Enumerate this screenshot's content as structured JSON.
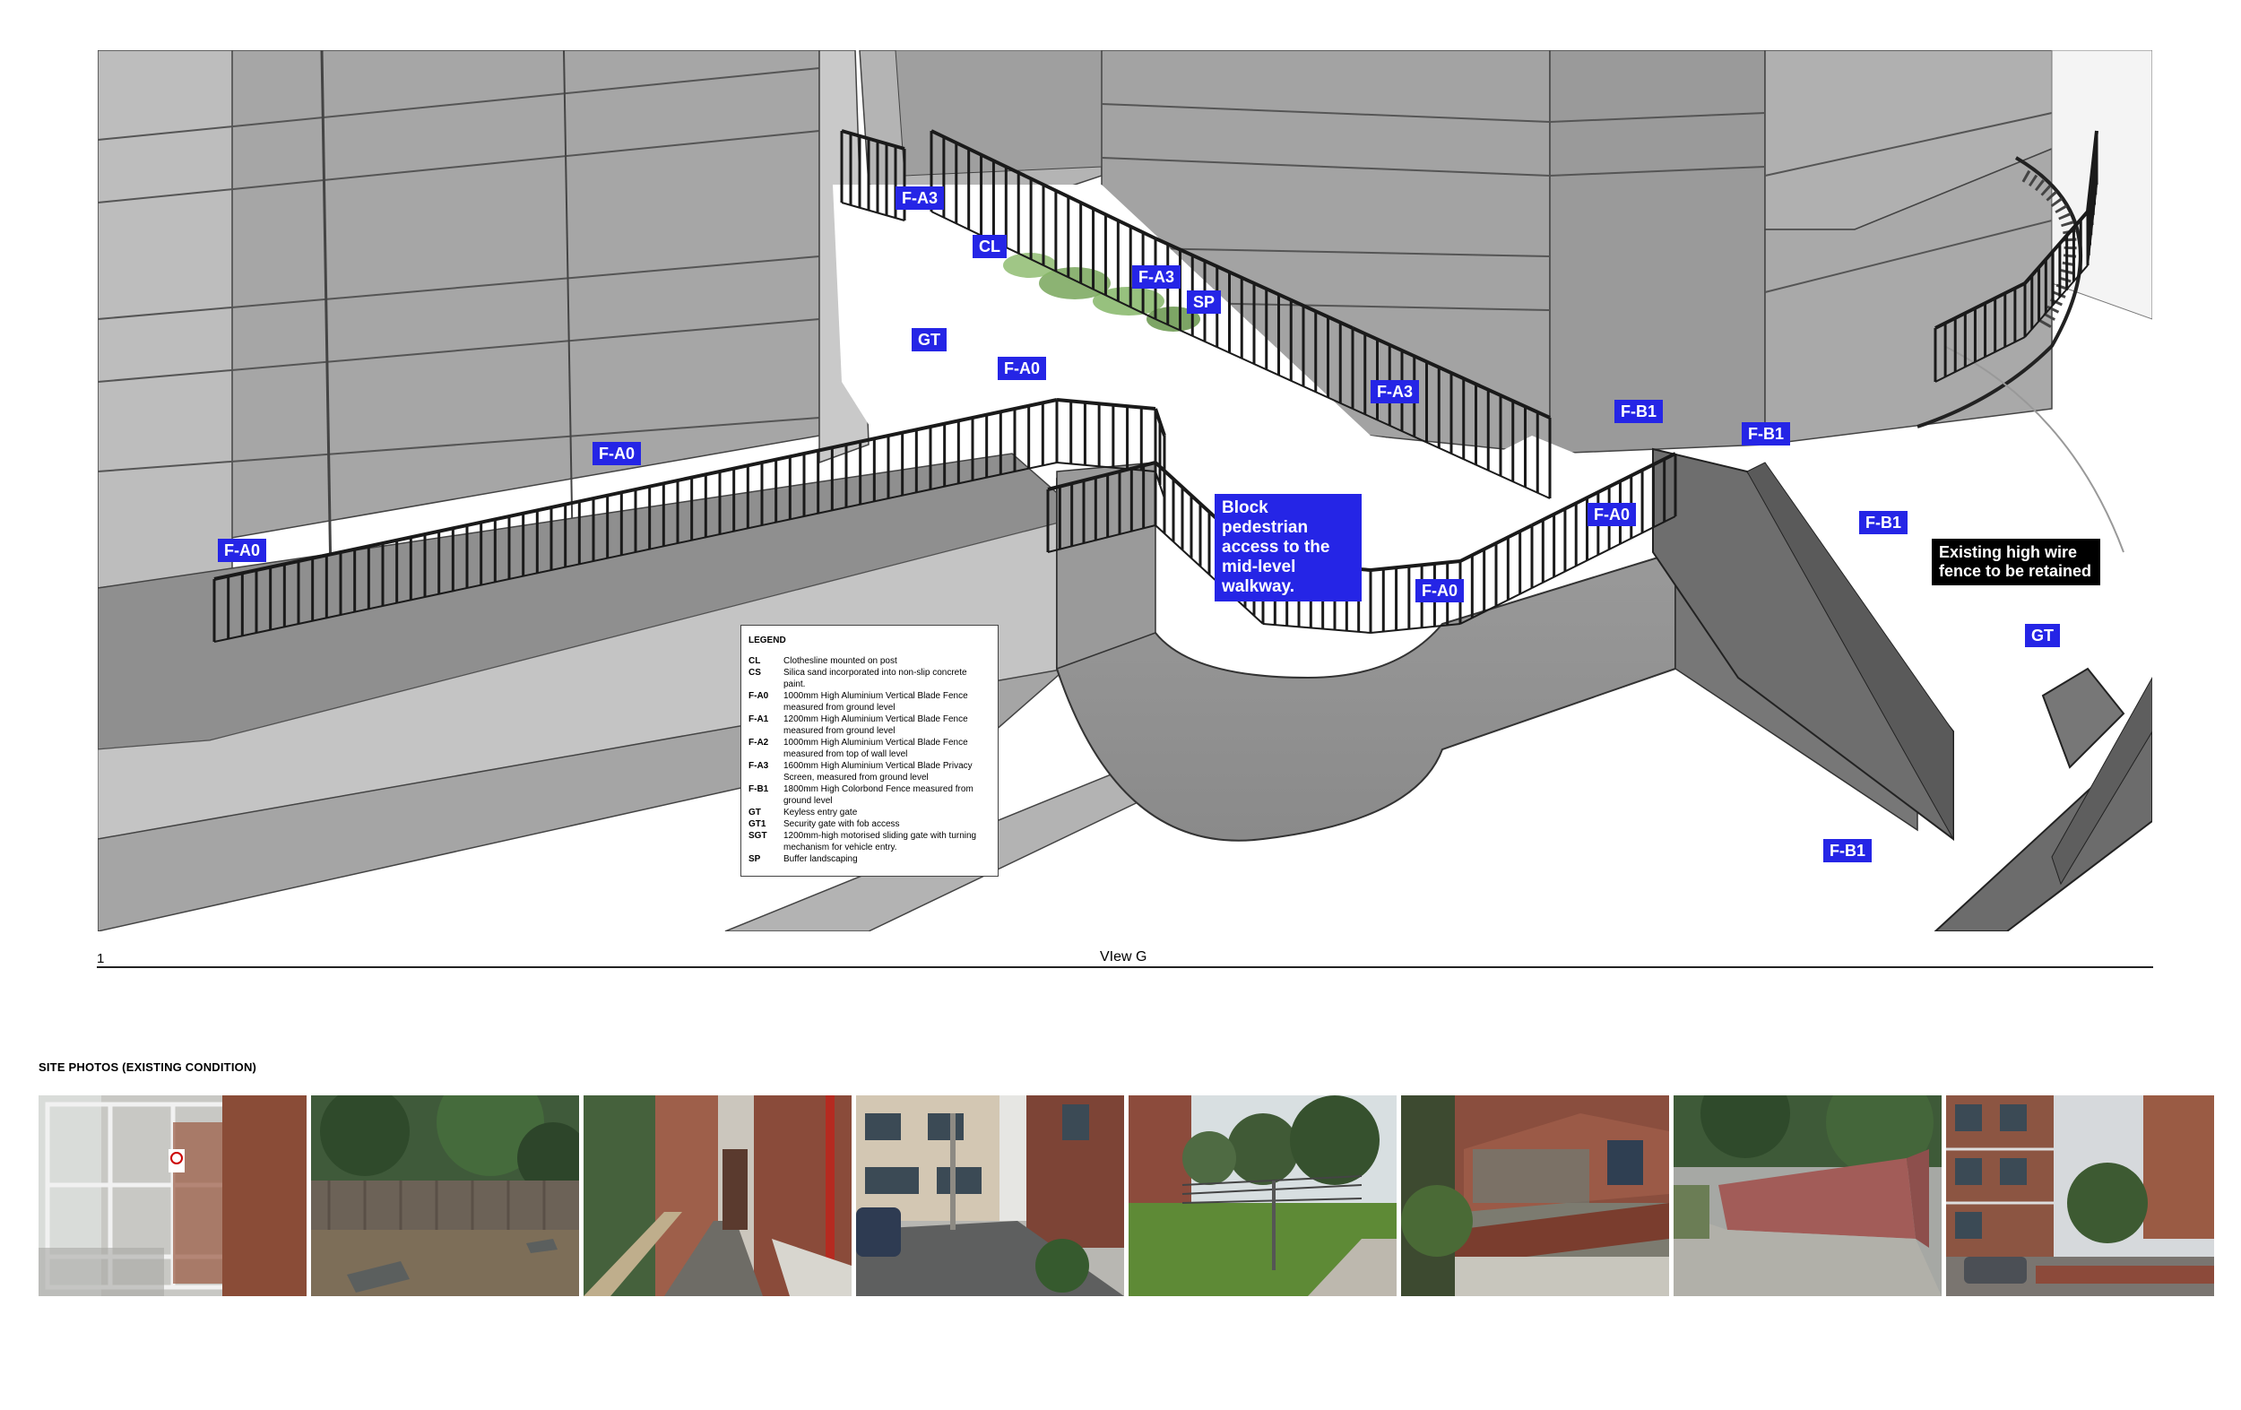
{
  "drawing": {
    "view_number": "1",
    "view_title": "VIew G",
    "callouts": {
      "fa3_top": "F-A3",
      "cl": "CL",
      "fa3_mid": "F-A3",
      "sp": "SP",
      "gt_top": "GT",
      "fa0_top": "F-A0",
      "fa0_left": "F-A0",
      "fa0_far_left": "F-A0",
      "fa3_right": "F-A3",
      "fb1_a": "F-B1",
      "fb1_b": "F-B1",
      "fa0_right": "F-A0",
      "fa0_bottom": "F-A0",
      "fb1_c": "F-B1",
      "gt_right": "GT",
      "fb1_bottom": "F-B1"
    },
    "notes": {
      "block_pedestrian": "Block pedestrian access to the mid-level walkway.",
      "existing_fence": "Existing high wire fence to be retained"
    }
  },
  "legend": {
    "title": "LEGEND",
    "items": [
      {
        "code": "CL",
        "desc": "Clothesline mounted on post"
      },
      {
        "code": "CS",
        "desc": "Silica sand incorporated into non-slip concrete paint."
      },
      {
        "code": "F-A0",
        "desc": "1000mm High Aluminium Vertical Blade Fence measured from ground level"
      },
      {
        "code": "F-A1",
        "desc": "1200mm High Aluminium Vertical Blade Fence measured from ground level"
      },
      {
        "code": "F-A2",
        "desc": "1000mm High Aluminium Vertical Blade Fence measured from top of wall level"
      },
      {
        "code": "F-A3",
        "desc": "1600mm High Aluminium Vertical Blade Privacy Screen, measured from ground level"
      },
      {
        "code": "F-B1",
        "desc": "1800mm High Colorbond Fence measured from ground level"
      },
      {
        "code": "GT",
        "desc": "Keyless entry gate"
      },
      {
        "code": "GT1",
        "desc": "Security gate with fob access"
      },
      {
        "code": "SGT",
        "desc": "1200mm-high motorised sliding gate with turning mechanism for vehicle entry."
      },
      {
        "code": "SP",
        "desc": "Buffer landscaping"
      }
    ]
  },
  "site_photos": {
    "heading": "SITE PHOTOS (EXISTING CONDITION)",
    "count": 8
  },
  "colors": {
    "callout_blue": "#2525e6",
    "building_grey": "#a9a9a9",
    "fence_black": "#1a1a1a"
  }
}
